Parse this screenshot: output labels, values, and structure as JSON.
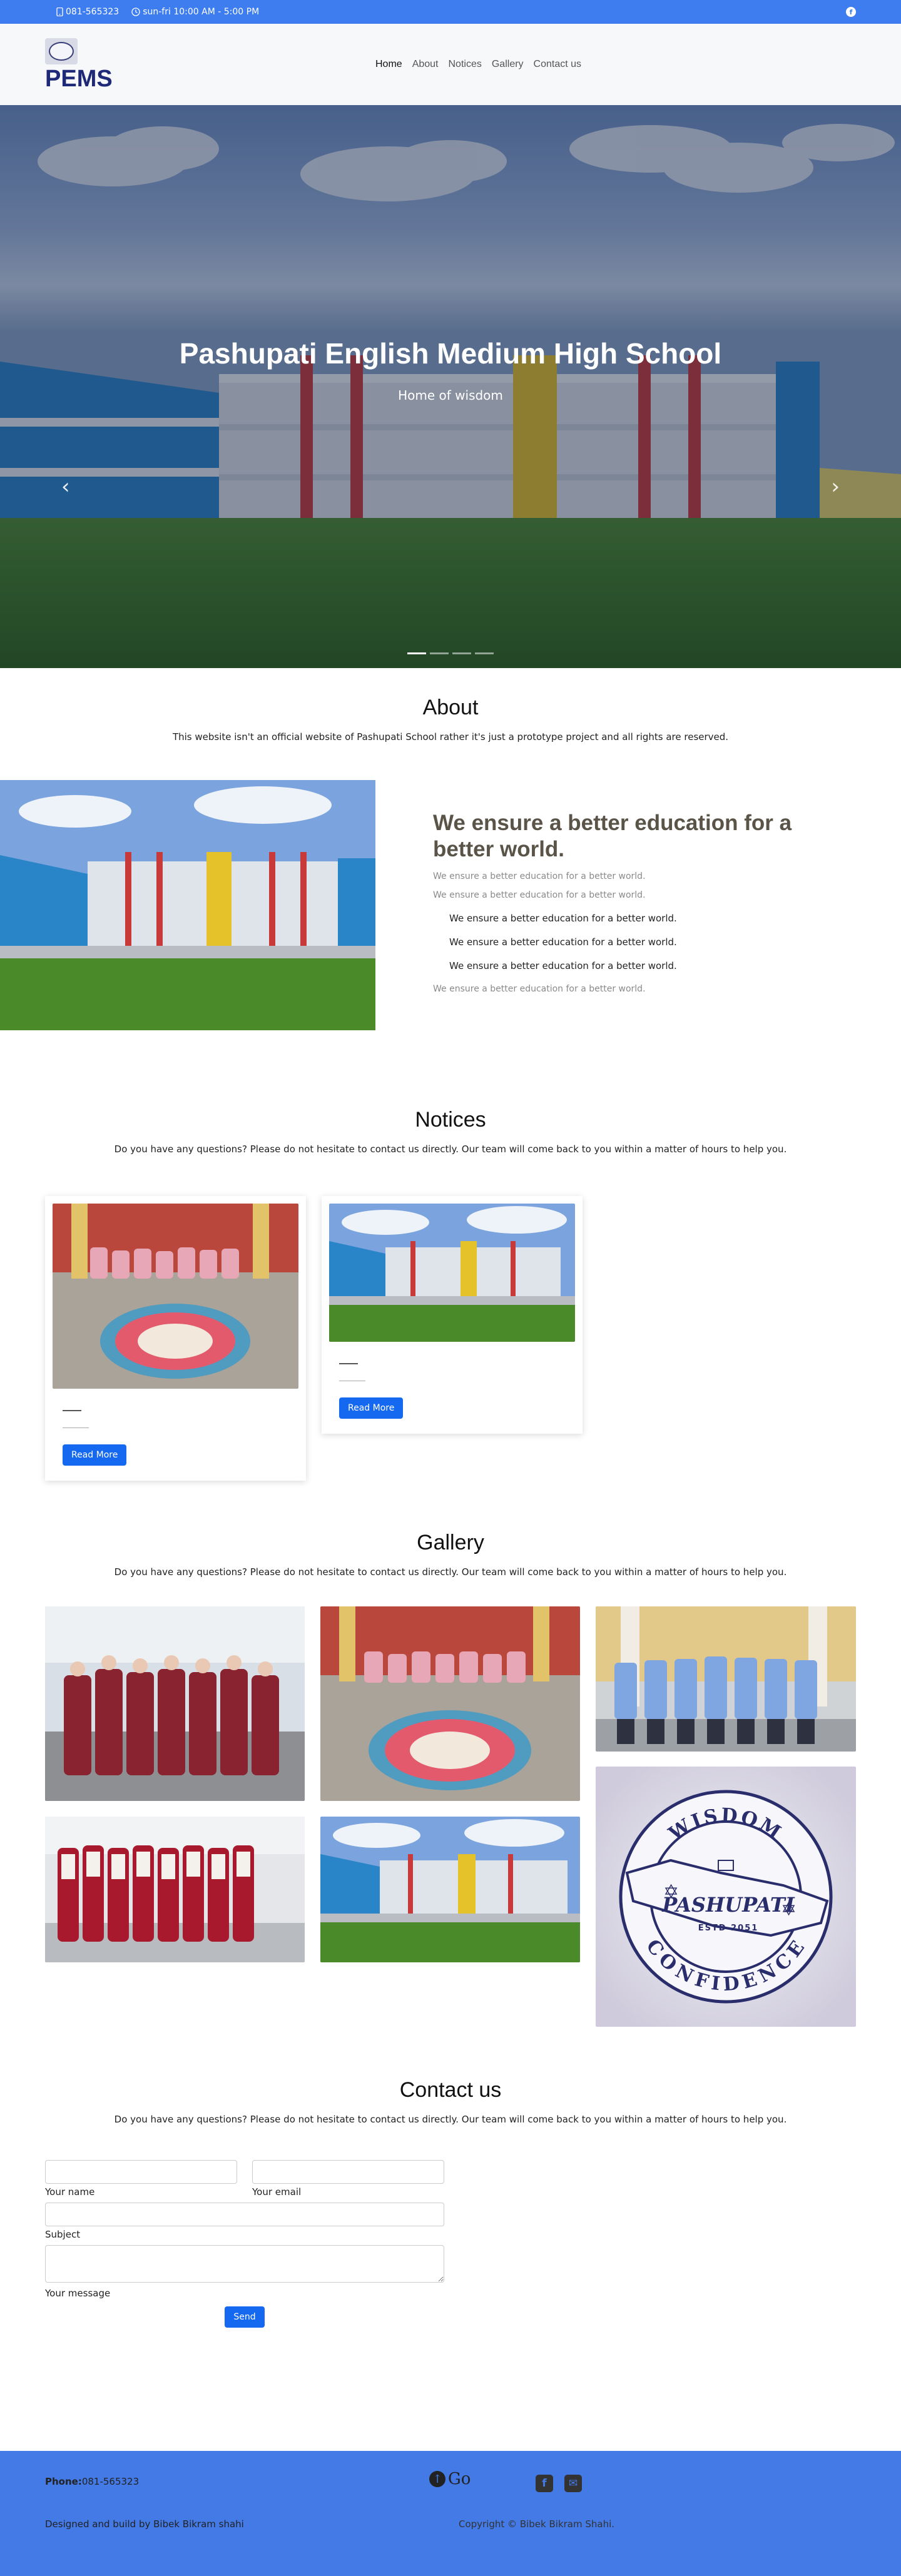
{
  "topbar": {
    "phone": "081-565323",
    "hours": "sun-fri 10:00 AM - 5:00 PM",
    "phone_icon": "phone-icon",
    "clock_icon": "clock-icon",
    "facebook_icon": "facebook-icon"
  },
  "header": {
    "brand": "PEMS",
    "nav": [
      "Home",
      "About",
      "Notices",
      "Gallery",
      "Contact us"
    ],
    "active": "Home"
  },
  "hero": {
    "title": "Pashupati English Medium High School",
    "subtitle": "Home of wisdom",
    "prev_icon": "chevron-left-icon",
    "next_icon": "chevron-right-icon",
    "slides": 4,
    "active_slide": 1
  },
  "about": {
    "title": "About",
    "subtitle": "This website isn't an official website of Pashupati School rather it's just a prototype project and all rights are reserved.",
    "heading": "We ensure a better education for a better world.",
    "muted_1": "We ensure a better education for a better world.",
    "muted_2": "We ensure a better education for a better world.",
    "list": [
      "We ensure a better education for a better world.",
      "We ensure a better education for a better world.",
      "We ensure a better education for a better world."
    ],
    "muted_3": "We ensure a better education for a better world."
  },
  "notices": {
    "title": "Notices",
    "subtitle": "Do you have any questions? Please do not hesitate to contact us directly. Our team will come back to you within a matter of hours to help you.",
    "cards": [
      {
        "button": "Read More"
      },
      {
        "button": "Read More"
      }
    ]
  },
  "gallery": {
    "title": "Gallery",
    "subtitle": "Do you have any questions? Please do not hesitate to contact us directly. Our team will come back to you within a matter of hours to help you.",
    "logo_text_top": "WISDOM",
    "logo_text_mid": "PASHUPATI",
    "logo_text_est": "ESTD 2051",
    "logo_text_bottom": "CONFIDENCE"
  },
  "contact": {
    "title": "Contact us",
    "subtitle": "Do you have any questions? Please do not hesitate to contact us directly. Our team will come back to you within a matter of hours to help you.",
    "name_label": "Your name",
    "email_label": "Your email",
    "subject_label": "Subject",
    "message_label": "Your message",
    "send": "Send"
  },
  "footer": {
    "phone_label": "Phone:",
    "phone": "081-565323",
    "designed": "Designed and build by Bibek Bikram shahi",
    "go": "Go",
    "go_icon": "arrow-up-circle-icon",
    "facebook_icon": "facebook-square-icon",
    "mail_icon": "envelope-square-icon",
    "copyright": "Copyright © Bibek Bikram Shahi."
  },
  "colors": {
    "topbar": "#3e7df0",
    "brand": "#1e2a78",
    "primary_button": "#1569f0",
    "footer": "#437ae6"
  }
}
